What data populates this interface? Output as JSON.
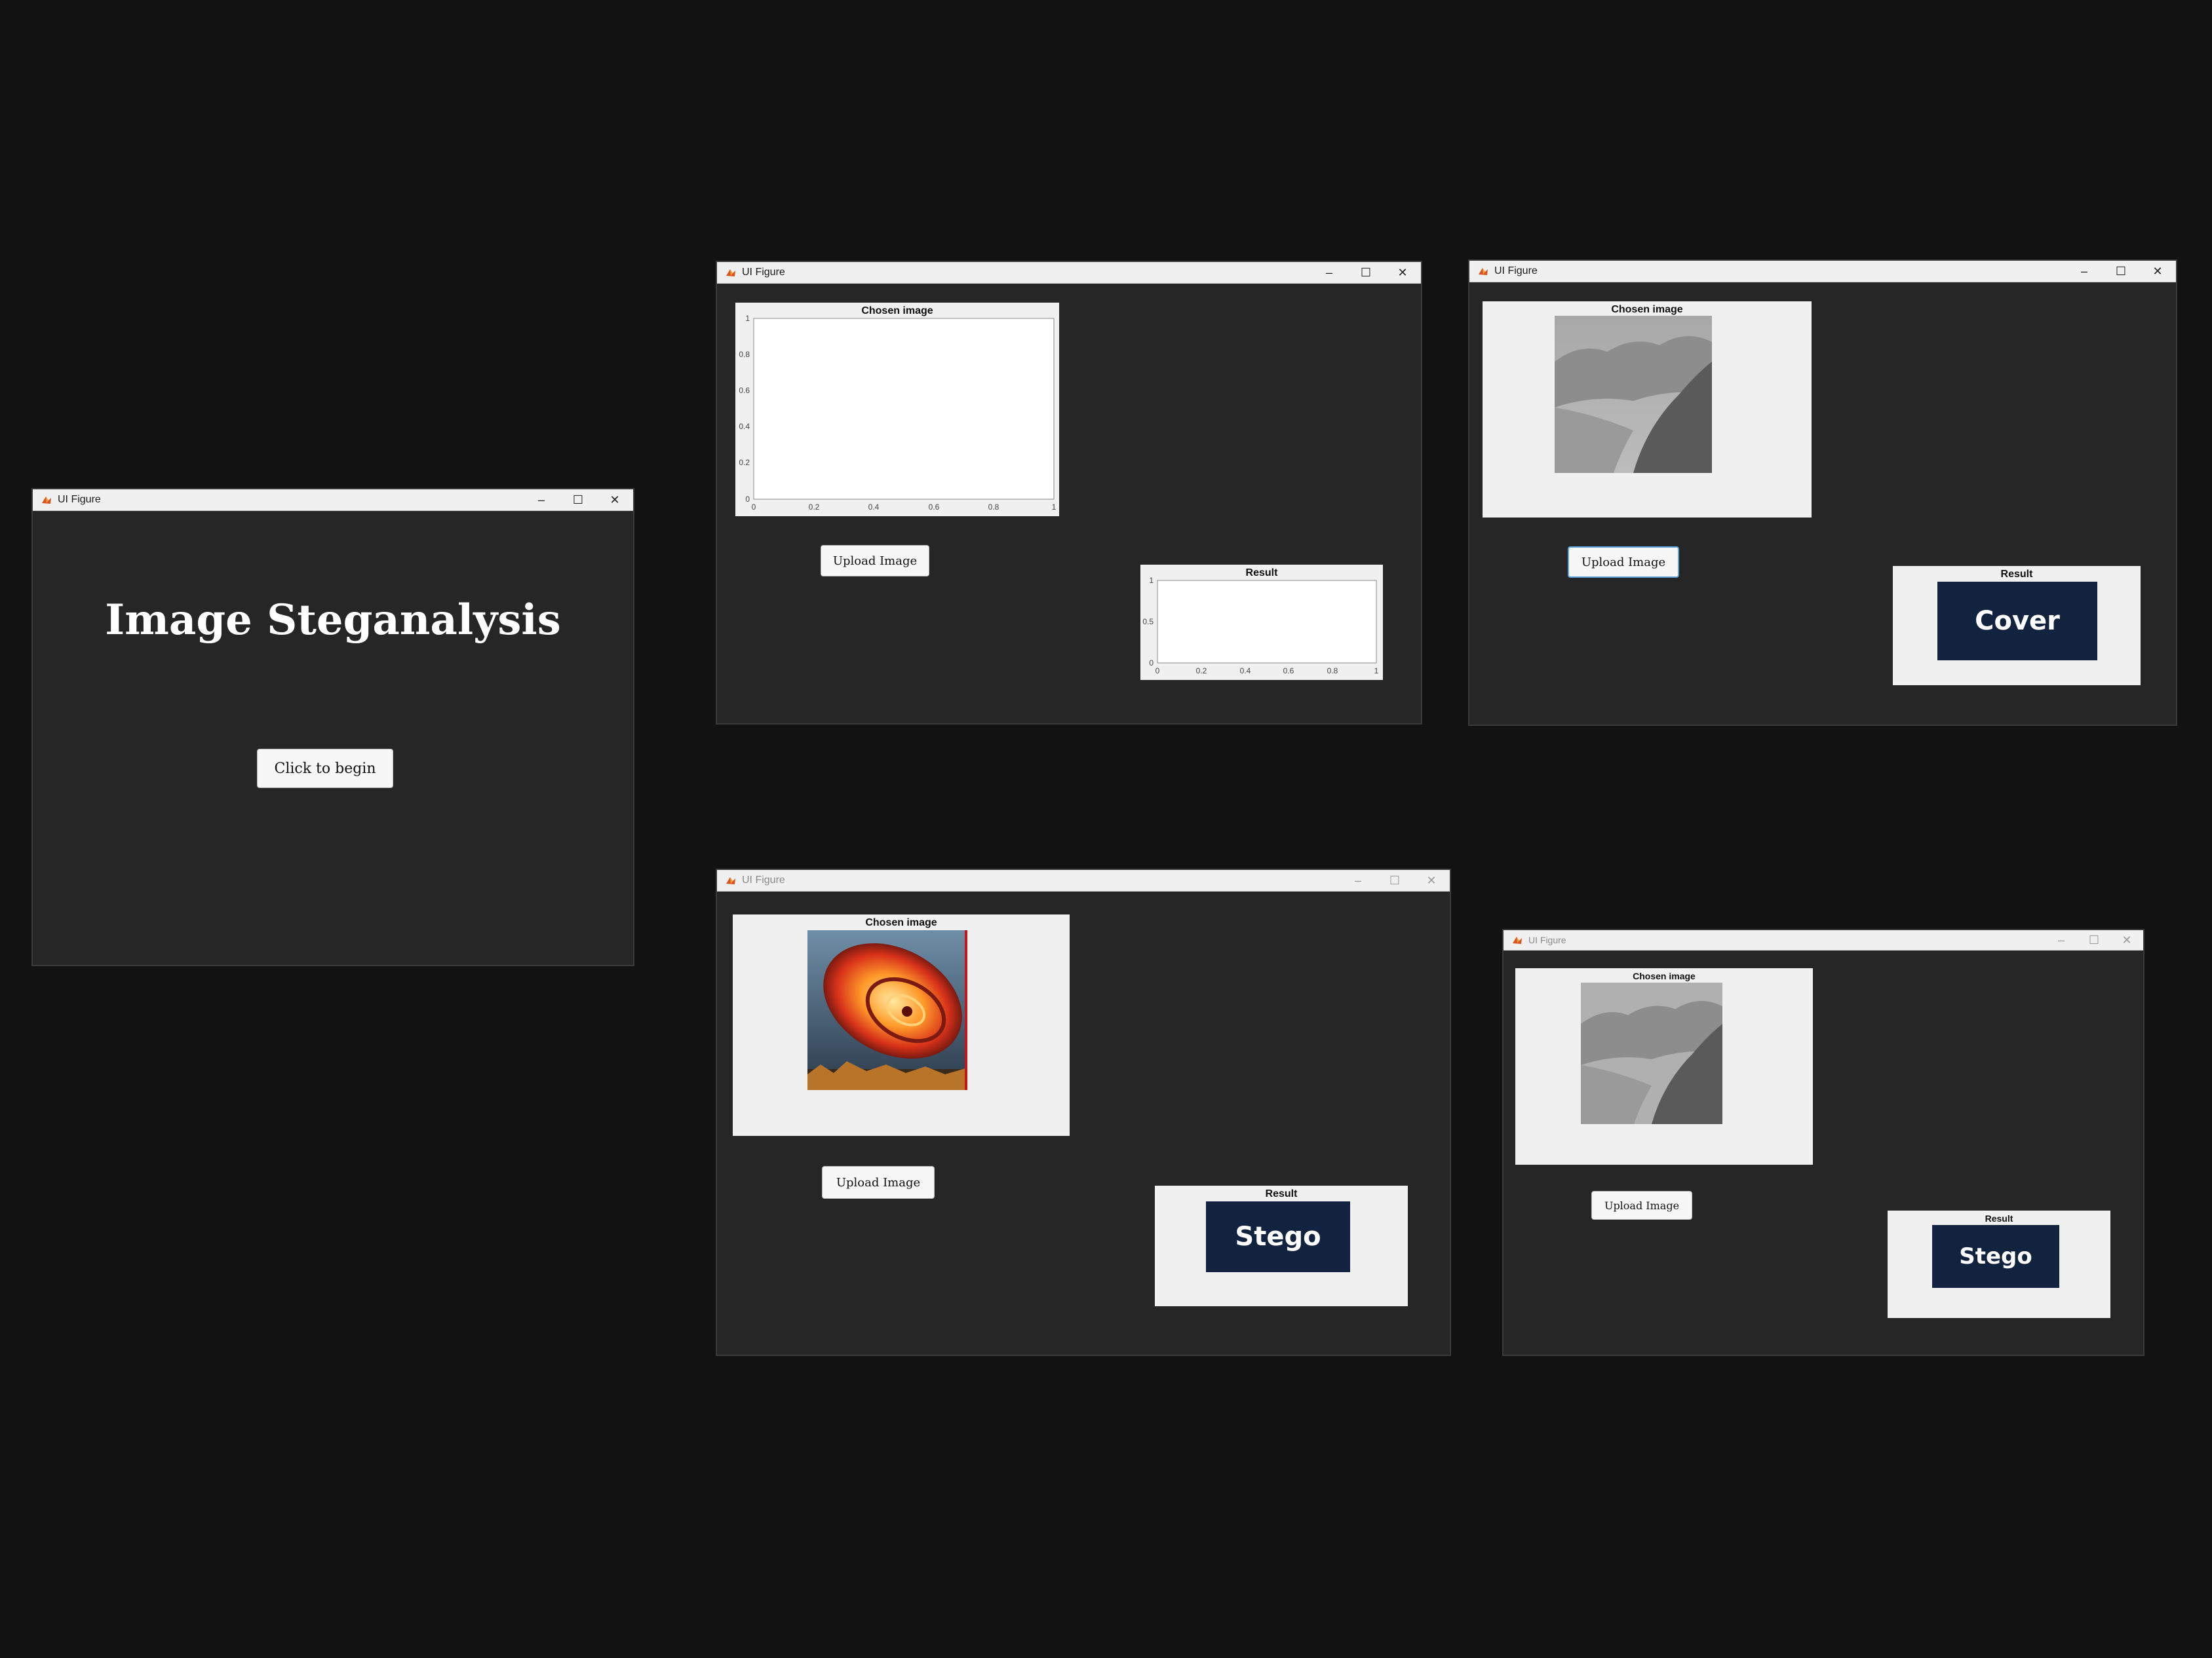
{
  "window_title": "UI Figure",
  "controls": {
    "minimize": "–",
    "maximize": "☐",
    "close": "✕"
  },
  "welcome": {
    "heading": "Image Steganalysis",
    "begin_button": "Click to begin"
  },
  "panels": {
    "chosen_title": "Chosen image",
    "result_title": "Result",
    "upload_button": "Upload Image"
  },
  "axes_ticks": {
    "chosen_y": [
      "0",
      "0.2",
      "0.4",
      "0.6",
      "0.8",
      "1"
    ],
    "chosen_x": [
      "0",
      "0.2",
      "0.4",
      "0.6",
      "0.8",
      "1"
    ],
    "result_y": [
      "0",
      "0.5",
      "1"
    ],
    "result_x": [
      "0",
      "0.2",
      "0.4",
      "0.6",
      "0.8",
      "1"
    ]
  },
  "results": {
    "cover": "Cover",
    "stego_a": "Stego",
    "stego_b": "Stego"
  },
  "icons": {
    "app": "matlab-icon",
    "minimize": "minimize-icon",
    "maximize": "maximize-icon",
    "close": "close-icon"
  },
  "colors": {
    "window_bg": "#262626",
    "desktop_bg": "#121212",
    "result_box": "#11233f",
    "panel_bg": "#f0f0f0"
  }
}
